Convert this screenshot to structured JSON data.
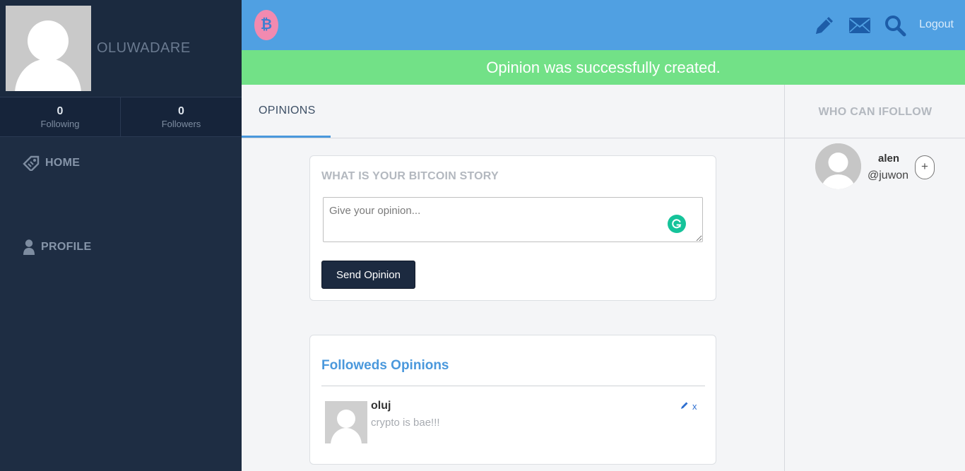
{
  "profile": {
    "username": "OLUWADARE",
    "following_count": "0",
    "following_label": "Following",
    "followers_count": "0",
    "followers_label": "Followers"
  },
  "nav": {
    "home_label": "HOME",
    "profile_label": "PROFILE"
  },
  "topbar": {
    "logo_glyph": "₿",
    "icons": [
      "pencil-icon",
      "envelope-icon",
      "search-icon"
    ],
    "logout_label": "Logout",
    "bg_color": "#50a0e2"
  },
  "flash": {
    "message": "Opinion was successfully created.",
    "color": "#72e187"
  },
  "tabs": {
    "opinions_label": "OPINIONS"
  },
  "form": {
    "title": "WHAT IS YOUR BITCOIN STORY",
    "placeholder": "Give your opinion...",
    "submit_label": "Send Opinion"
  },
  "feed": {
    "title": "Followeds Opinions",
    "posts": [
      {
        "author": "oluj",
        "text": "crypto is bae!!!",
        "delete_label": "x"
      }
    ]
  },
  "suggestions": {
    "title": "WHO CAN IFOLLOW",
    "users": [
      {
        "name": "alen",
        "handle": "@juwon",
        "follow_label": "+"
      }
    ]
  }
}
